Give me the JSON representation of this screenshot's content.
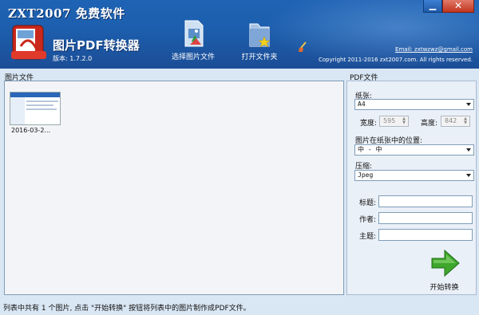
{
  "header": {
    "brand": "ZXT2007 免费软件",
    "app_name": "图片PDF转换器",
    "version": "版本: 1.7.2.0",
    "email": "Email: zxtwzwz@gmail.com",
    "copyright": "Copyright 2011-2016 zxt2007.com. All rights reserved.",
    "window_controls": {
      "minimize": "▁",
      "close": "✕"
    }
  },
  "toolbar": {
    "select_images_label": "选择图片文件",
    "open_folder_label": "打开文件夹",
    "clear_icon": "broom-icon"
  },
  "image_list": {
    "title": "图片文件",
    "items": [
      {
        "label": "2016-03-2..."
      }
    ]
  },
  "pdf_settings": {
    "title": "PDF文件",
    "paper_label": "纸张:",
    "paper_value": "A4",
    "width_label": "宽度:",
    "width_value": "595",
    "height_label": "高度:",
    "height_value": "842",
    "position_label": "图片在纸张中的位置:",
    "position_value": "中 - 中",
    "compression_label": "压缩:",
    "compression_value": "Jpeg",
    "title_field_label": "标题:",
    "author_field_label": "作者:",
    "subject_field_label": "主题:",
    "title_value": "",
    "author_value": "",
    "subject_value": ""
  },
  "start_button": {
    "label": "开始转换"
  },
  "status_bar": {
    "text": "列表中共有 1 个图片, 点击 \"开始转换\" 按钮将列表中的图片制作成PDF文件。"
  },
  "colors": {
    "header_blue": "#1d5fae",
    "panel_bg": "#d9e6f3",
    "arrow_green": "#3fa62c"
  }
}
